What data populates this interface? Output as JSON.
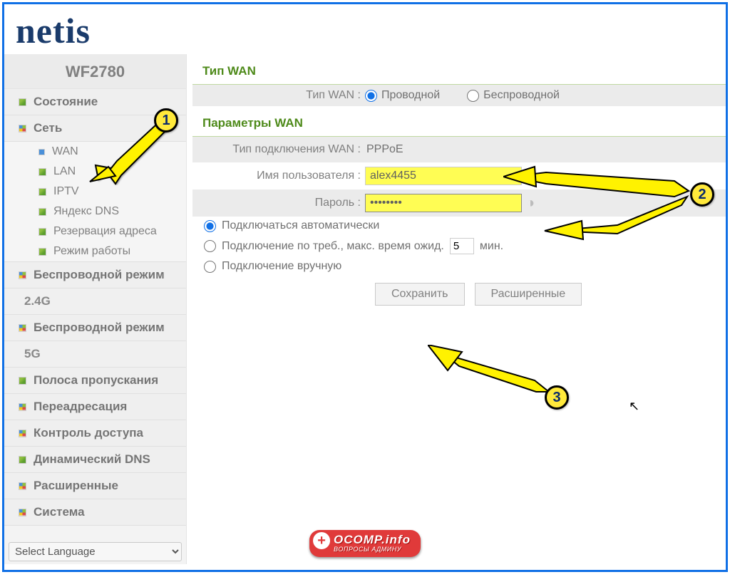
{
  "logo": "netis",
  "model": "WF2780",
  "sidebar": {
    "items": [
      {
        "label": "Состояние",
        "type": "main",
        "icon": "green"
      },
      {
        "label": "Сеть",
        "type": "main",
        "icon": "multi"
      },
      {
        "label": "WAN",
        "type": "child",
        "icon": "small"
      },
      {
        "label": "LAN",
        "type": "child",
        "icon": "green"
      },
      {
        "label": "IPTV",
        "type": "child",
        "icon": "green"
      },
      {
        "label": "Яндекс DNS",
        "type": "child",
        "icon": "green"
      },
      {
        "label": "Резервация адреса",
        "type": "child",
        "icon": "green"
      },
      {
        "label": "Режим работы",
        "type": "child",
        "icon": "green"
      },
      {
        "label": "Беспроводной режим",
        "type": "main",
        "icon": "multi"
      },
      {
        "label": "2.4G",
        "type": "sub",
        "icon": ""
      },
      {
        "label": "Беспроводной режим",
        "type": "main",
        "icon": "multi"
      },
      {
        "label": "5G",
        "type": "sub",
        "icon": ""
      },
      {
        "label": "Полоса пропускания",
        "type": "main",
        "icon": "green"
      },
      {
        "label": "Переадресация",
        "type": "main",
        "icon": "multi"
      },
      {
        "label": "Контроль доступа",
        "type": "main",
        "icon": "multi"
      },
      {
        "label": "Динамический DNS",
        "type": "main",
        "icon": "green"
      },
      {
        "label": "Расширенные",
        "type": "main",
        "icon": "multi"
      },
      {
        "label": "Система",
        "type": "main",
        "icon": "multi"
      }
    ],
    "language": "Select Language"
  },
  "main": {
    "section_wan_type": "Тип WAN",
    "wan_type_label": "Тип WAN :",
    "wan_type_wired": "Проводной",
    "wan_type_wireless": "Беспроводной",
    "section_wan_params": "Параметры WAN",
    "conn_type_label": "Тип подключения WAN :",
    "conn_type_value": "PPPoE",
    "username_label": "Имя пользователя :",
    "username_value": "alex4455",
    "password_label": "Пароль :",
    "password_value": "••••••••",
    "opt_auto": "Подключаться автоматически",
    "opt_ondemand_pre": "Подключение по треб., макс. время ожид.",
    "opt_ondemand_val": "5",
    "opt_ondemand_suf": "мин.",
    "opt_manual": "Подключение вручную",
    "btn_save": "Сохранить",
    "btn_advanced": "Расширенные"
  },
  "annotations": {
    "m1": "1",
    "m2": "2",
    "m3": "3"
  },
  "watermark": {
    "title": "OCOMP.info",
    "subtitle": "ВОПРОСЫ АДМИНУ"
  }
}
